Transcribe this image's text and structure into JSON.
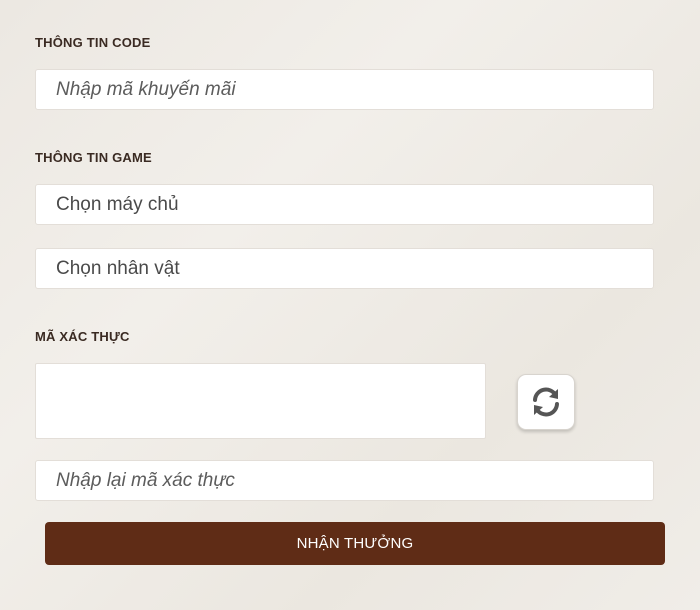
{
  "code_section": {
    "label": "THÔNG TIN CODE",
    "promo_placeholder": "Nhập mã khuyến mãi"
  },
  "game_section": {
    "label": "THÔNG TIN GAME",
    "server_select": "Chọn máy chủ",
    "character_select": "Chọn nhân vật"
  },
  "captcha_section": {
    "label": "MÃ XÁC THỰC",
    "refresh_icon": "refresh-icon",
    "confirm_placeholder": "Nhập lại mã xác thực"
  },
  "submit_label": "NHẬN THƯỞNG",
  "colors": {
    "button_bg": "#5f2c16",
    "label_text": "#3a2a22"
  }
}
